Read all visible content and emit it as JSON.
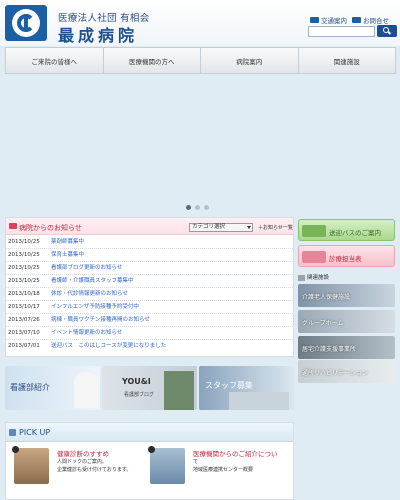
{
  "header": {
    "org_line": "医療法人社団 有相会",
    "hospital_name": "最成病院",
    "top_links": [
      "交通案内",
      "お問合せ"
    ],
    "search_placeholder": ""
  },
  "nav": {
    "items": [
      "ご来院の皆様へ",
      "医療機関の方へ",
      "病院案内",
      "関連施設"
    ]
  },
  "slider": {
    "active_index": 0,
    "dot_count": 3
  },
  "news": {
    "title": "病院からのお知らせ",
    "category_select": "カテゴリ選択",
    "list_link": "＋お知らせ一覧",
    "items": [
      {
        "date": "2013/10/25",
        "title": "薬剤師募集中"
      },
      {
        "date": "2013/10/25",
        "title": "保育士募集中"
      },
      {
        "date": "2013/10/25",
        "title": "看護部ブログ更新のお知らせ"
      },
      {
        "date": "2013/10/25",
        "title": "看護師・介護職員スタッフ募集中"
      },
      {
        "date": "2013/10/18",
        "title": "休診・代診情報更新のお知らせ"
      },
      {
        "date": "2013/10/17",
        "title": "インフルエンザ予防接種予約受付中"
      },
      {
        "date": "2013/07/26",
        "title": "病棟・職員ワクチン接種再開のお知らせ"
      },
      {
        "date": "2013/07/10",
        "title": "イベント情報更新のお知らせ"
      },
      {
        "date": "2013/07/01",
        "title": "送迎バス　このはしコースが変更になりました"
      }
    ]
  },
  "banners": {
    "nursing": "看護部紹介",
    "you_and_i": "YOU&I",
    "you_and_i_sub": "看護部ブログ",
    "staff": "スタッフ募集"
  },
  "pickup": {
    "title": "PICK UP",
    "items": [
      {
        "title": "健康診断のすすめ",
        "desc": [
          "人間ドックのご案内。",
          "企業健診も受け付けております。"
        ]
      },
      {
        "title": "医療機関からのご紹介につい",
        "desc": [
          "て",
          "地域医療連携センター概要"
        ]
      }
    ]
  },
  "sidebar": {
    "bus_label": "送迎バスのご案内",
    "schedule_label": "診療担当表",
    "related_heading": "関連施設",
    "related_tiles": [
      "介護老人保健施設",
      "グループホーム",
      "居宅介護支援事業所",
      "通所リハビリテーション"
    ]
  },
  "colors": {
    "accent_blue": "#1d4f8f",
    "news_red": "#c02840",
    "link_blue": "#3366cc",
    "bus_green": "#7cc060",
    "schedule_pink": "#f3a4b0"
  }
}
